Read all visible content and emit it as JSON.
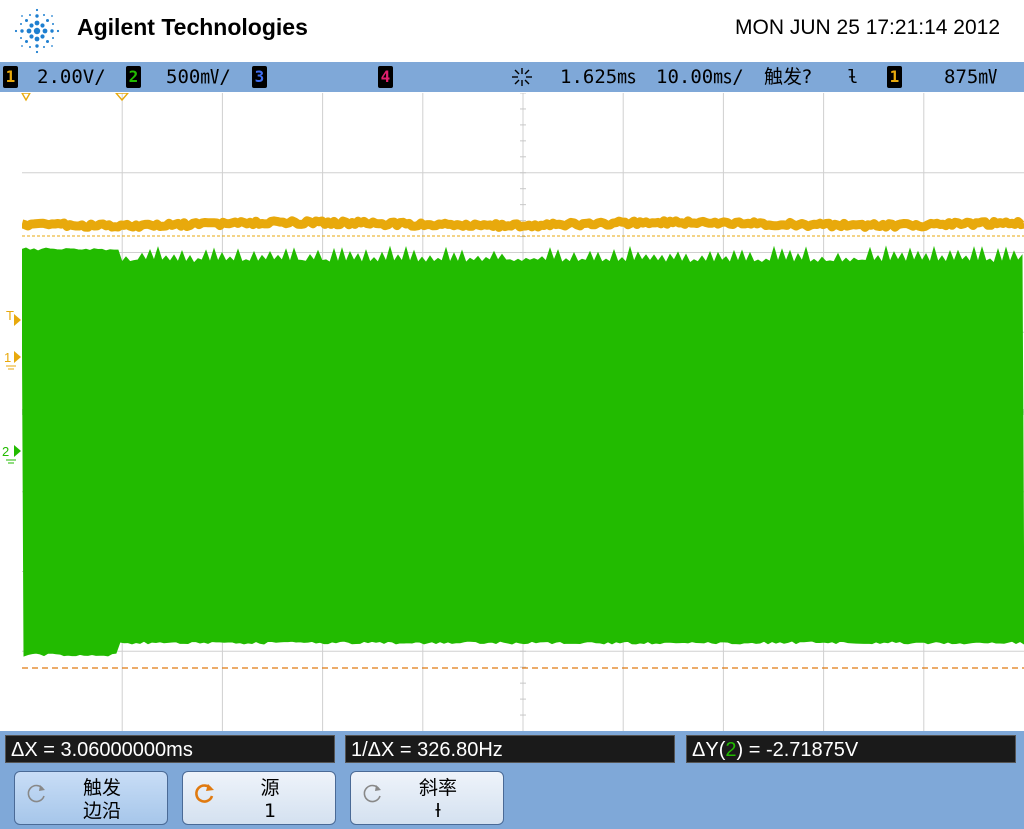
{
  "header": {
    "brand": "Agilent Technologies",
    "datetime": "MON JUN 25 17:21:14 2012",
    "logo_icon": "agilent-spark-logo"
  },
  "status": {
    "ch1_label": "1",
    "ch1_scale": "2.00V/",
    "ch2_label": "2",
    "ch2_scale": "500㎷/",
    "ch3_label": "3",
    "ch4_label": "4",
    "trigger_icon": "acquisition-run-icon",
    "delay": "1.625㎳",
    "timebase": "10.00㎳/",
    "trigger_status": "触发?",
    "slope_symbol": "ƚ",
    "trig_source": "1",
    "trig_level": "875㎷",
    "colors": {
      "ch1": "#e8a90c",
      "ch2": "#22bb00",
      "ch3": "#3f6ef0",
      "ch4": "#e0206e"
    }
  },
  "screen_markers": {
    "trigger_marker": "T",
    "ch1_marker": "1",
    "ch2_marker": "2"
  },
  "measurements": {
    "delta_x": "ΔX = 3.06000000ms",
    "inv_delta_x": "1/ΔX = 326.80Hz",
    "delta_y_prefix": "ΔY(",
    "delta_y_channel": "2",
    "delta_y_suffix": ") = -2.71875V"
  },
  "softkeys": [
    {
      "line1": "触发",
      "line2": "边沿",
      "icon": "rotary-knob-icon",
      "active": true
    },
    {
      "line1": "源",
      "line2": "1",
      "icon": "rotary-knob-icon-orange",
      "active": false
    },
    {
      "line1": "斜率",
      "line2": "ƚ",
      "icon": "rotary-knob-icon",
      "active": false
    }
  ]
}
